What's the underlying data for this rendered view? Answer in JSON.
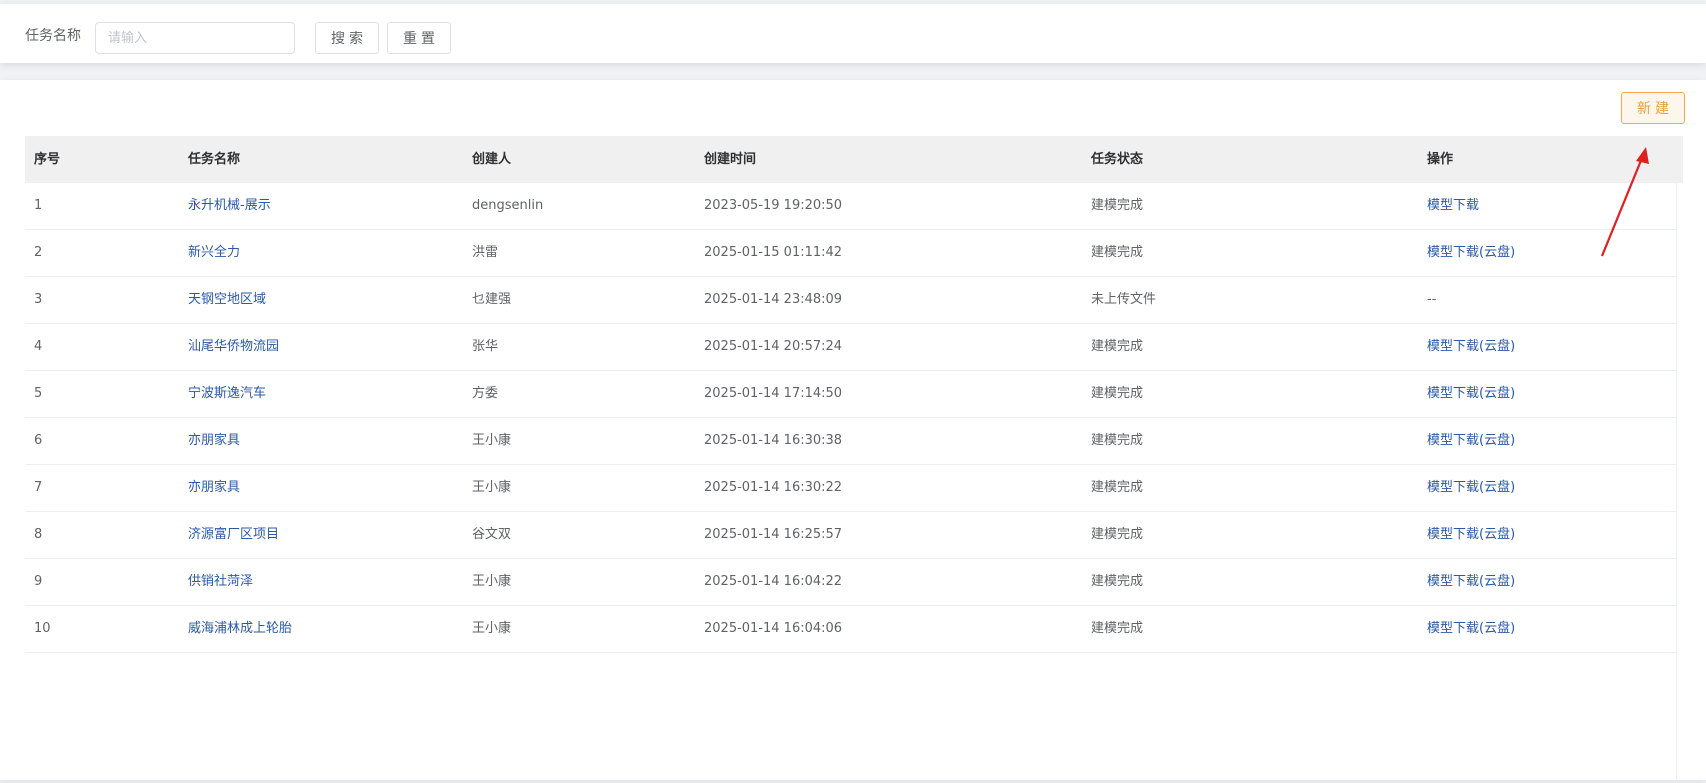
{
  "search": {
    "label": "任务名称",
    "placeholder": "请输入",
    "value": "",
    "search_button": "搜索",
    "reset_button": "重置"
  },
  "toolbar": {
    "new_button": "新建"
  },
  "table": {
    "headers": {
      "index": "序号",
      "name": "任务名称",
      "creator": "创建人",
      "created_time": "创建时间",
      "status": "任务状态",
      "operation": "操作"
    },
    "rows": [
      {
        "index": "1",
        "name": "永升机械-展示",
        "creator": "dengsenlin",
        "created_time": "2023-05-19 19:20:50",
        "status": "建模完成",
        "operation": "模型下载"
      },
      {
        "index": "2",
        "name": "新兴全力",
        "creator": "洪雷",
        "created_time": "2025-01-15 01:11:42",
        "status": "建模完成",
        "operation": "模型下载(云盘)"
      },
      {
        "index": "3",
        "name": "天钢空地区域",
        "creator": "乜建强",
        "created_time": "2025-01-14 23:48:09",
        "status": "未上传文件",
        "operation": "--"
      },
      {
        "index": "4",
        "name": "汕尾华侨物流园",
        "creator": "张华",
        "created_time": "2025-01-14 20:57:24",
        "status": "建模完成",
        "operation": "模型下载(云盘)"
      },
      {
        "index": "5",
        "name": "宁波斯逸汽车",
        "creator": "方委",
        "created_time": "2025-01-14 17:14:50",
        "status": "建模完成",
        "operation": "模型下载(云盘)"
      },
      {
        "index": "6",
        "name": "亦朋家具",
        "creator": "王小康",
        "created_time": "2025-01-14 16:30:38",
        "status": "建模完成",
        "operation": "模型下载(云盘)"
      },
      {
        "index": "7",
        "name": "亦朋家具",
        "creator": "王小康",
        "created_time": "2025-01-14 16:30:22",
        "status": "建模完成",
        "operation": "模型下载(云盘)"
      },
      {
        "index": "8",
        "name": "济源富厂区项目",
        "creator": "谷文双",
        "created_time": "2025-01-14 16:25:57",
        "status": "建模完成",
        "operation": "模型下载(云盘)"
      },
      {
        "index": "9",
        "name": "供销社菏泽",
        "creator": "王小康",
        "created_time": "2025-01-14 16:04:22",
        "status": "建模完成",
        "operation": "模型下载(云盘)"
      },
      {
        "index": "10",
        "name": "威海浦林成上轮胎",
        "creator": "王小康",
        "created_time": "2025-01-14 16:04:06",
        "status": "建模完成",
        "operation": "模型下载(云盘)"
      }
    ]
  },
  "colors": {
    "link": "#2a59a8",
    "warning": "#e6a23c",
    "header_bg": "#f0f0f0",
    "arrow": "#e02020"
  },
  "annotations": {
    "arrow_icon": "red-arrow-pointing-to-new-button"
  }
}
